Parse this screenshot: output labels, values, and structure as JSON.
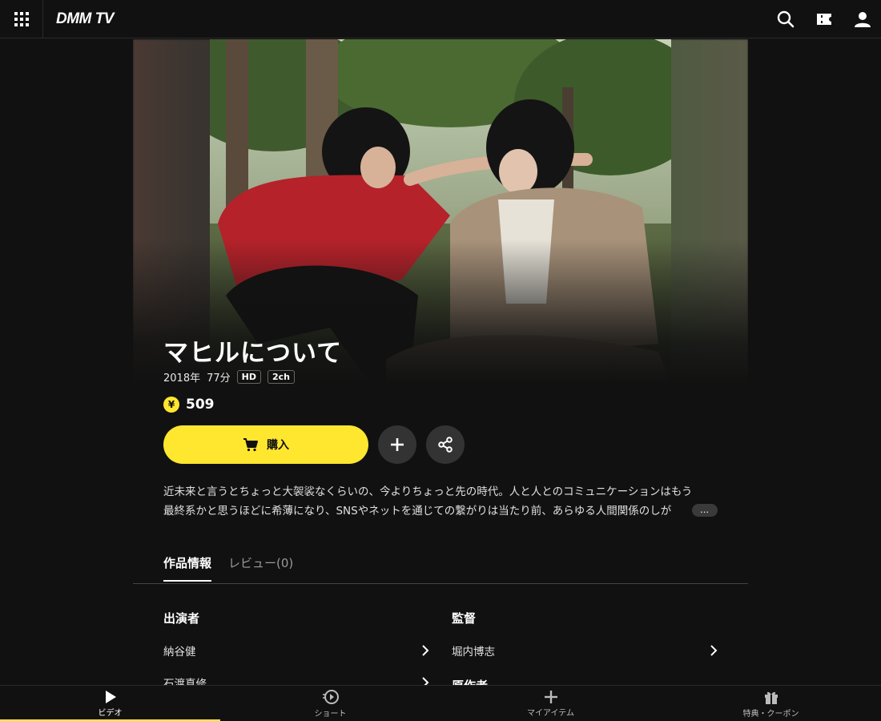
{
  "header": {
    "logo_text": "DMM TV",
    "icons": [
      "grid-menu-icon",
      "search-icon",
      "ticket-icon",
      "user-icon"
    ]
  },
  "hero": {
    "image_description": "promotional still"
  },
  "title": "マヒルについて",
  "meta": {
    "year": "2018年",
    "duration": "77分",
    "badges": [
      "HD",
      "2ch"
    ]
  },
  "price": {
    "currency_symbol": "¥",
    "amount": "509"
  },
  "actions": {
    "buy_label": "購入",
    "add_icon": "plus-icon",
    "share_icon": "share-icon"
  },
  "description": {
    "line1": "近未来と言うとちょっと大袈裟なくらいの、今よりちょっと先の時代。人と人とのコミュニケーションはもう",
    "line2": "最終系かと思うほどに希薄になり、SNSやネットを通じての繋がりは当たり前、あらゆる人間関係のしが",
    "more_label": "…"
  },
  "tabs": [
    {
      "label": "作品情報",
      "active": true
    },
    {
      "label": "レビュー(0)",
      "active": false
    }
  ],
  "credits": {
    "cast_title": "出演者",
    "cast": [
      "納谷健",
      "石渡真修"
    ],
    "director_title": "監督",
    "directors": [
      "堀内博志"
    ],
    "next_section_title": "原作者"
  },
  "bottom_nav": [
    {
      "label": "ビデオ",
      "icon": "play-icon",
      "active": true
    },
    {
      "label": "ショート",
      "icon": "short-video-icon",
      "active": false
    },
    {
      "label": "マイアイテム",
      "icon": "plus-icon",
      "active": false
    },
    {
      "label": "特典・クーポン",
      "icon": "gift-icon",
      "active": false
    }
  ],
  "colors": {
    "accent": "#ffe72f",
    "background": "#111111"
  }
}
